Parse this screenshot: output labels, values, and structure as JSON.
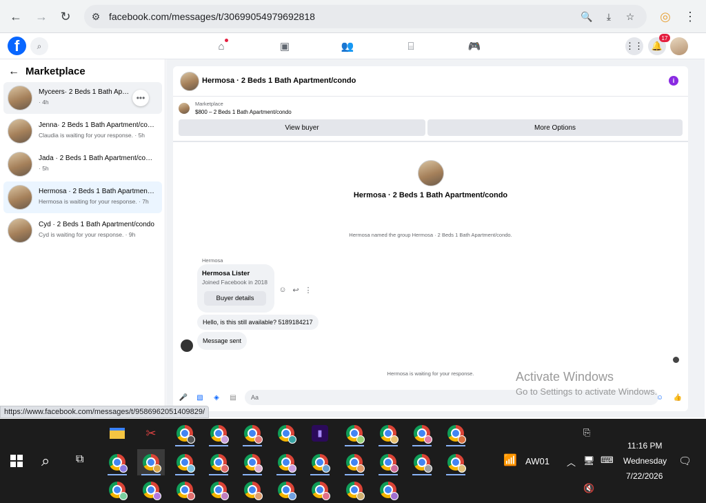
{
  "browser": {
    "url": "facebook.com/messages/t/30699054979692818",
    "status_url": "https://www.facebook.com/messages/t/9586962051409829/"
  },
  "fb": {
    "notification_count": "17"
  },
  "sidebar": {
    "title": "Marketplace",
    "conversations": [
      {
        "name": "Myceers· 2 Beds 1 Bath Apartment/condo",
        "sub": "· 4h"
      },
      {
        "name": "Jenna· 2 Beds 1 Bath Apartment/condo",
        "sub": "Claudia is waiting for your response. · 5h"
      },
      {
        "name": "Jada · 2 Beds 1 Bath Apartment/condo",
        "sub": "· 5h"
      },
      {
        "name": "Hermosa · 2 Beds 1 Bath Apartment/condo",
        "sub": "Hermosa is waiting for your response. · 7h"
      },
      {
        "name": "Cyd · 2 Beds 1 Bath Apartment/condo",
        "sub": "Cyd is waiting for your response. · 9h"
      }
    ]
  },
  "chat": {
    "title": "Hermosa · 2 Beds 1 Bath Apartment/condo",
    "marketplace_label": "Marketplace",
    "price_line": "$800 – 2 Beds 1 Bath Apartment/condo",
    "view_buyer": "View buyer",
    "more_options": "More Options",
    "group_title": "Hermosa · 2 Beds 1 Bath Apartment/condo",
    "system_named": "Hermosa named the group Hermosa · 2 Beds 1 Bath Apartment/condo.",
    "sender": "Hermosa",
    "card_name": "Hermosa Lister",
    "card_sub": "Joined Facebook in 2018",
    "buyer_details": "Buyer details",
    "message1": "Hello, is this still available? 5189184217",
    "message2": "Message sent",
    "waiting": "Hermosa is waiting for your response.",
    "composer_placeholder": "Aa"
  },
  "watermark": {
    "line1": "Activate Windows",
    "line2": "Go to Settings to activate Windows."
  },
  "taskbar": {
    "weather": "AW01",
    "time": "11:16 PM",
    "day": "Wednesday",
    "date": "7/22/2026"
  }
}
